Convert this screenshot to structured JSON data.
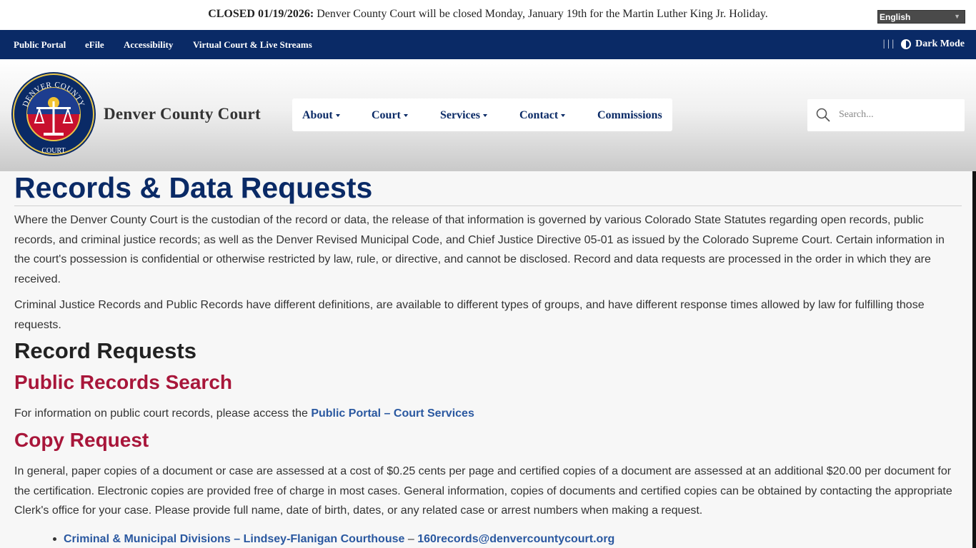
{
  "alert": {
    "bold": "CLOSED 01/19/2026:",
    "text": " Denver County Court will be closed Monday, January 19th for the Martin Luther King Jr. Holiday."
  },
  "language": {
    "selected": "English"
  },
  "top_nav": {
    "links": [
      "Public Portal",
      "eFile",
      "Accessibility",
      "Virtual Court & Live Streams"
    ],
    "separators": "| | |",
    "dark_mode": "Dark Mode"
  },
  "header": {
    "site_title": "Denver County Court",
    "seal_text_top": "DENVER COUNTY",
    "seal_text_bottom": "COURT",
    "menu": [
      {
        "label": "About",
        "dropdown": true
      },
      {
        "label": "Court",
        "dropdown": true
      },
      {
        "label": "Services",
        "dropdown": true
      },
      {
        "label": "Contact",
        "dropdown": true
      },
      {
        "label": "Commissions",
        "dropdown": false
      }
    ],
    "search_placeholder": "Search..."
  },
  "content": {
    "title": "Records & Data Requests",
    "intro_1": "Where the Denver County Court is the custodian of the record or data, the release of that information is governed by various Colorado State Statutes regarding open records, public records, and criminal justice records; as well as the Denver Revised Municipal Code, and Chief Justice Directive 05-01 as issued by the Colorado Supreme Court. Certain information in the court's possession is confidential or otherwise restricted by law, rule, or directive, and cannot be disclosed. Record and data requests are processed in the order in which they are received.",
    "intro_2": "Criminal Justice Records and Public Records have different definitions, are available to different types of groups, and have different response times allowed by law for fulfilling those requests.",
    "record_requests_heading": "Record Requests",
    "public_records_heading": "Public Records Search",
    "public_records_text": "For information on public court records, please access the ",
    "public_records_link": "Public Portal – Court Services",
    "copy_request_heading": "Copy Request",
    "copy_request_text": "In general, paper copies of a document or case are assessed at a cost of $0.25 cents per page and certified copies of a document are assessed at an additional $20.00 per document for the certification. Electronic copies are provided free of charge in most cases. General information, copies of documents and certified copies can be obtained by contacting the appropriate Clerk's office for your case. Please provide full name, date of birth, dates, or any related case or arrest numbers when making a request.",
    "bullet_link": "Criminal & Municipal Divisions – Lindsey-Flanigan Courthouse",
    "bullet_sep": " – ",
    "bullet_email": "160records@denvercountycourt.org"
  },
  "colors": {
    "navy": "#0a2a66",
    "crimson": "#a8163a",
    "link": "#2a58a0"
  }
}
